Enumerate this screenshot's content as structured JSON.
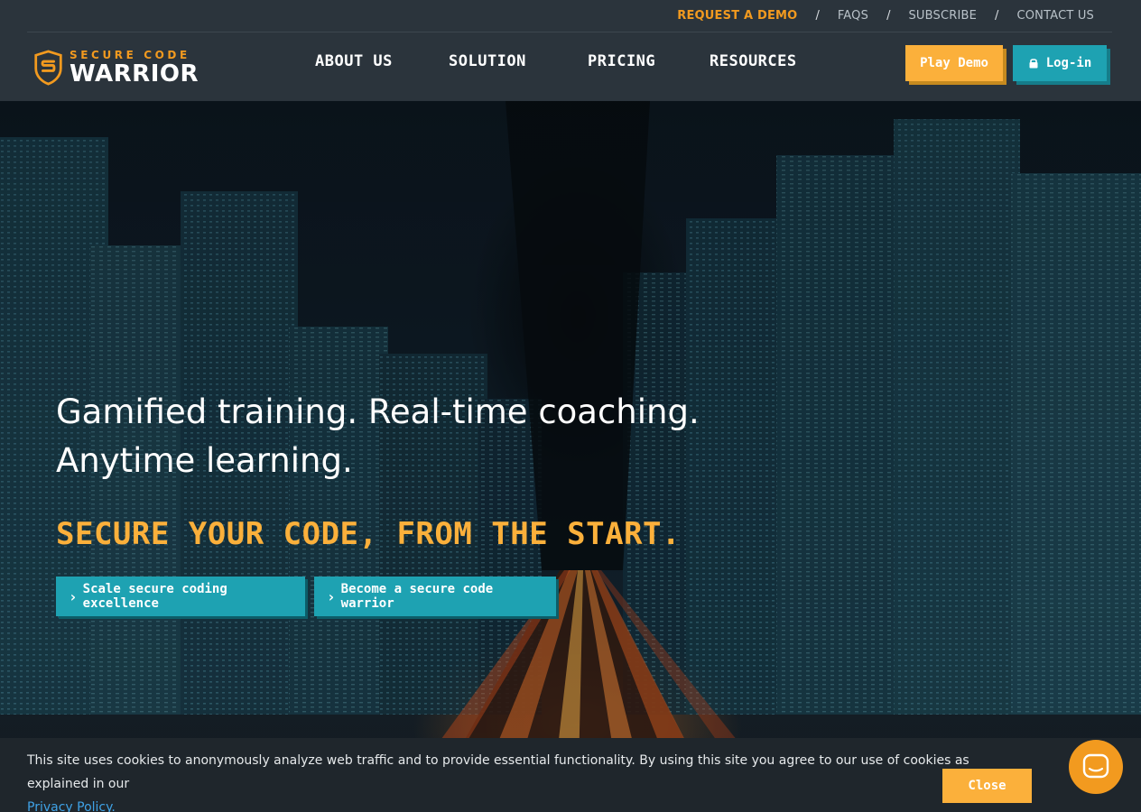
{
  "utility_nav": {
    "request_demo": "REQUEST A DEMO",
    "sep1": "/",
    "faqs": "FAQS",
    "sep2": "/",
    "subscribe": "SUBSCRIBE",
    "sep3": "/",
    "contact": "CONTACT US"
  },
  "logo": {
    "line1": "SECURE CODE",
    "line2": "WARRIOR"
  },
  "main_nav": {
    "about": "ABOUT US",
    "solution": "SOLUTION",
    "pricing": "PRICING",
    "resources": "RESOURCES"
  },
  "header_buttons": {
    "play_demo": "Play Demo",
    "login": "Log-in"
  },
  "hero": {
    "headline_line1": "Gamified training. Real-time coaching.",
    "headline_line2": "Anytime learning.",
    "tagline": "SECURE YOUR CODE, FROM THE START.",
    "cta1": "Scale secure coding excellence",
    "cta2": "Become a secure code warrior"
  },
  "cookie": {
    "text": "This site uses cookies to anonymously analyze web traffic and to provide essential functionality. By using this site you agree to our use of cookies as explained in our ",
    "link": "Privacy Policy.",
    "close": "Close"
  },
  "colors": {
    "accent_orange": "#f29a1f",
    "button_yellow": "#fbb03b",
    "button_teal": "#1ea2b2",
    "header_bg": "#2b343c"
  },
  "icons": {
    "logo": "shield-logo-icon",
    "login": "lock-icon",
    "cta": "chevron-right-icon",
    "chat": "chat-bubble-icon"
  }
}
